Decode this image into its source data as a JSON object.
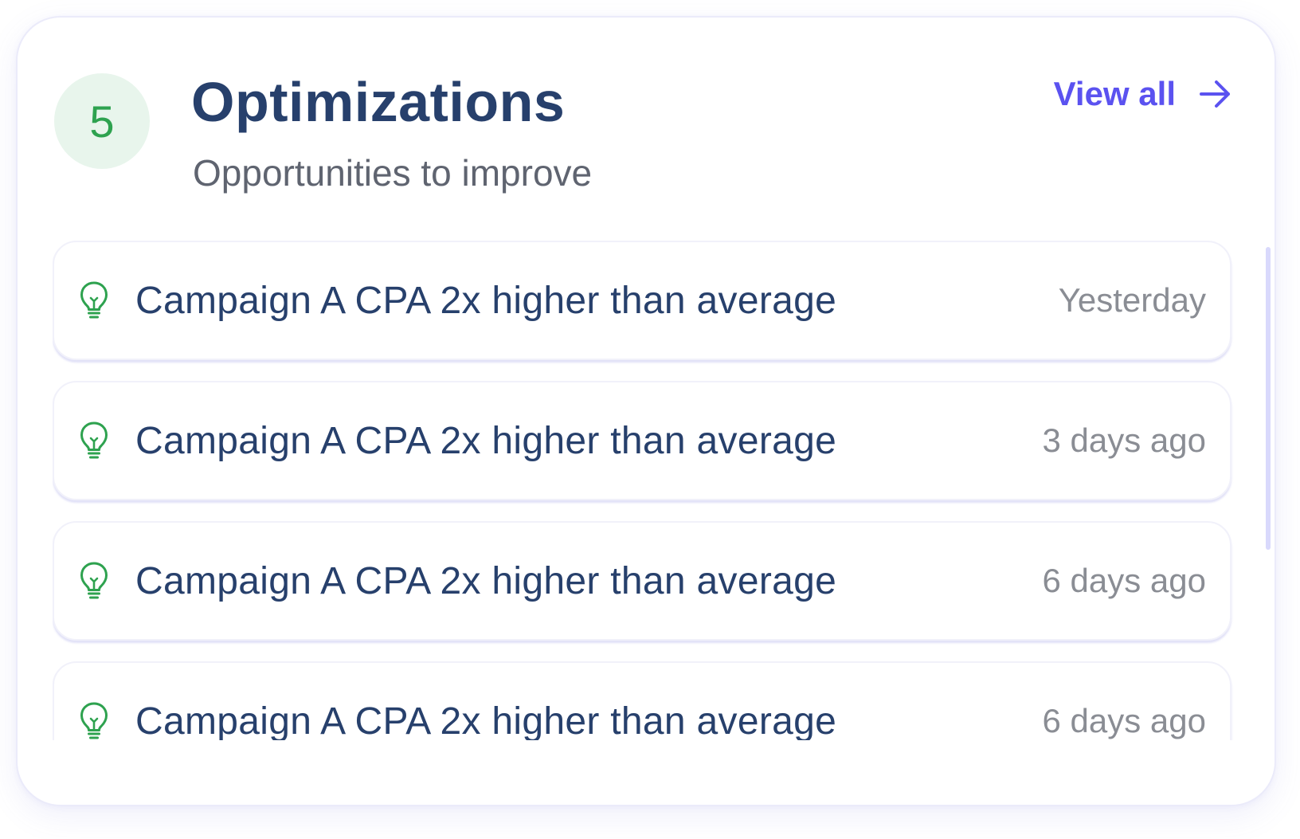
{
  "header": {
    "count": "5",
    "title": "Optimizations",
    "subtitle": "Opportunities to improve",
    "view_all_label": "View all",
    "view_all_icon": "arrow-right-icon"
  },
  "items": [
    {
      "icon": "lightbulb-icon",
      "text": "Campaign A CPA 2x higher than average",
      "time": "Yesterday"
    },
    {
      "icon": "lightbulb-icon",
      "text": "Campaign A CPA 2x higher than average",
      "time": "3 days ago"
    },
    {
      "icon": "lightbulb-icon",
      "text": "Campaign A CPA 2x higher than average",
      "time": "6 days ago"
    },
    {
      "icon": "lightbulb-icon",
      "text": "Campaign A CPA 2x higher than average",
      "time": "6 days ago"
    }
  ],
  "colors": {
    "accent": "#5b52f0",
    "success": "#2ea24f",
    "success_bg": "#e8f5ec",
    "title": "#27406c",
    "muted": "#8a8d94",
    "scrollbar": "#d9d9fc"
  }
}
